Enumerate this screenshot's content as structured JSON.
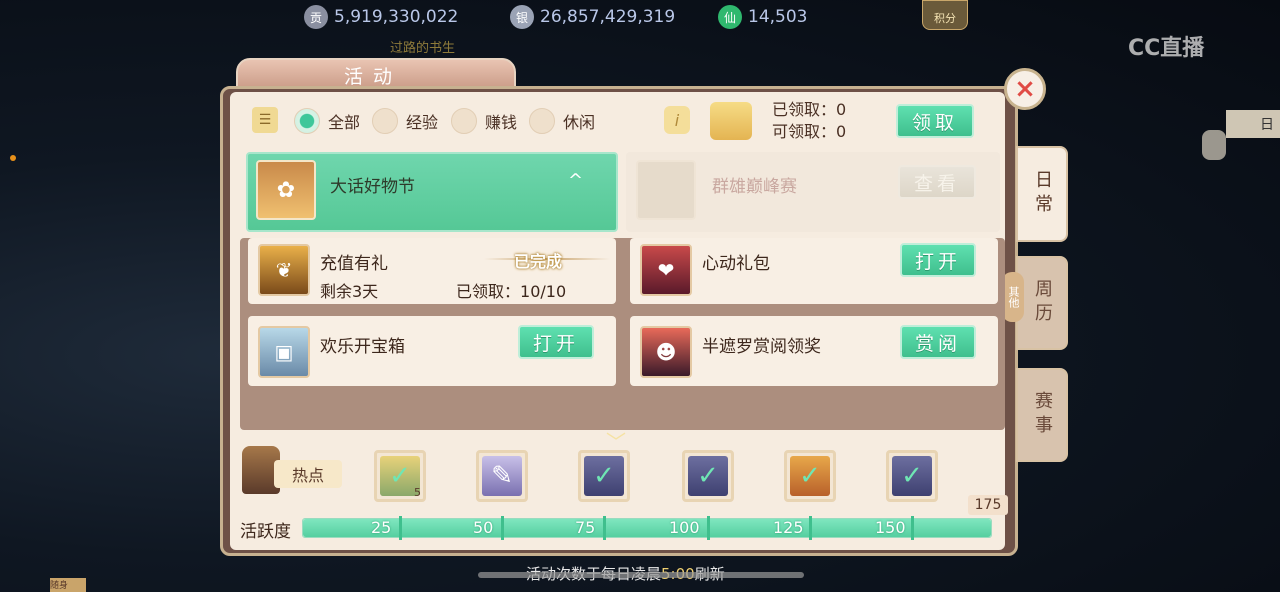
{
  "top_bar": {
    "currencies": [
      {
        "icon": "coin-gong-icon",
        "glyph": "贡",
        "value": "5,919,330,022"
      },
      {
        "icon": "silver-ingot-icon",
        "glyph": "银",
        "value": "26,857,429,319"
      },
      {
        "icon": "jade-icon",
        "glyph": "仙",
        "value": "14,503"
      }
    ],
    "points_badge": "积分",
    "player_subtitle": "过路的书生",
    "watermark": "CC直播"
  },
  "panel": {
    "title": "活动",
    "close_glyph": "×",
    "filters": [
      {
        "label": "全部",
        "selected": true
      },
      {
        "label": "经验",
        "selected": false
      },
      {
        "label": "赚钱",
        "selected": false
      },
      {
        "label": "休闲",
        "selected": false
      }
    ],
    "info_glyph": "i",
    "claimed_label": "已领取：",
    "claimed_value": "0",
    "claimable_label": "可领取：",
    "claimable_value": "0",
    "claim_button": "领取",
    "categories": {
      "selected": {
        "name": "大话好物节",
        "collapse_glyph": "^"
      },
      "other": {
        "name": "群雄巅峰赛",
        "button": "查看"
      }
    },
    "items": [
      {
        "name": "充值有礼",
        "status": "已完成",
        "remaining": "剩余3天",
        "progress_label": "已领取：",
        "progress_value": "10/10"
      },
      {
        "name": "心动礼包",
        "button": "打开"
      },
      {
        "name": "欢乐开宝箱",
        "button": "打开"
      },
      {
        "name": "半遮罗赏阅领奖",
        "button": "赏阅"
      }
    ],
    "side_tabs": [
      "日常",
      "周历",
      "赛事"
    ],
    "other_badge": "其他",
    "hot_label": "热点",
    "rewards": [
      {
        "icon": "gift-box-icon",
        "count": "5"
      },
      {
        "icon": "scroll-flower-icon",
        "count": ""
      },
      {
        "icon": "reward-claimed-icon",
        "count": ""
      },
      {
        "icon": "reward-claimed-icon",
        "count": ""
      },
      {
        "icon": "treasure-claimed-icon",
        "count": ""
      },
      {
        "icon": "reward-claimed-icon",
        "count": ""
      }
    ],
    "activity": {
      "label": "活跃度",
      "value": 175,
      "max_display": "175",
      "milestones": [
        "25",
        "50",
        "75",
        "100",
        "125",
        "150"
      ]
    },
    "footer_prefix": "活动次数于每日凌晨",
    "footer_time": "5:00",
    "footer_suffix": "刷新"
  },
  "background": {
    "corner_tab": "日",
    "bottom_tag": "随身"
  }
}
